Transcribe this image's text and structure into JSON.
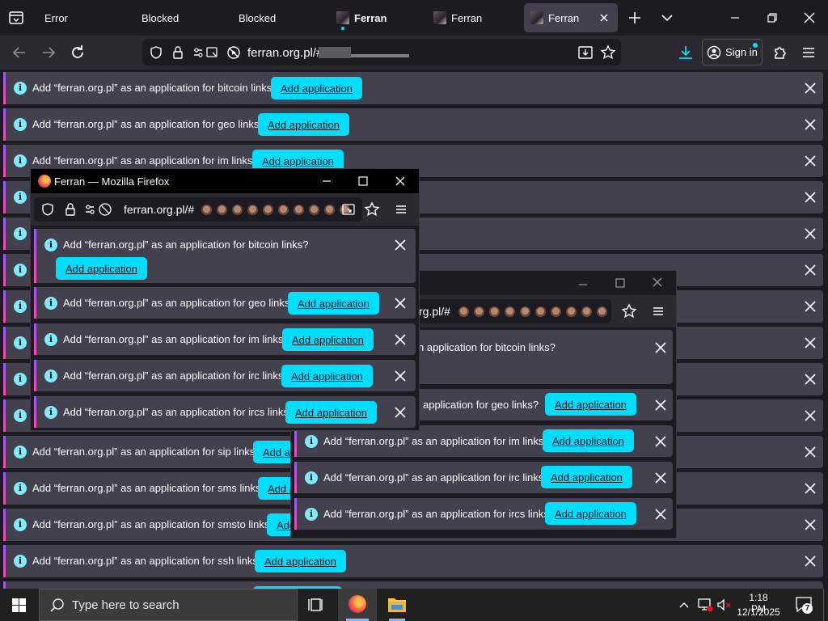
{
  "tabs": [
    {
      "label": "Error"
    },
    {
      "label": "Blocked"
    },
    {
      "label": "Blocked"
    },
    {
      "label": "Ferran"
    },
    {
      "label": "Ferran"
    },
    {
      "label": "Ferran"
    }
  ],
  "url": {
    "text": "ferran.org.pl/#"
  },
  "toolbar": {
    "signin_label": "Sign in"
  },
  "notifications": [
    {
      "message": "Add “ferran.org.pl” as an application for bitcoin links?",
      "button": "Add application"
    },
    {
      "message": "Add “ferran.org.pl” as an application for geo links?",
      "button": "Add application"
    },
    {
      "message": "Add “ferran.org.pl” as an application for im links?",
      "button": "Add application"
    },
    {
      "message": "Add “ferran.org.pl” as an application for sip links?",
      "button": "Add application"
    },
    {
      "message": "Add “ferran.org.pl” as an application for sms links?",
      "button": "Add application"
    },
    {
      "message": "Add “ferran.org.pl” as an application for smsto links?",
      "button": "Add application"
    },
    {
      "message": "Add “ferran.org.pl” as an application for ssh links?",
      "button": "Add application"
    }
  ],
  "popup1": {
    "title": "Ferran — Mozilla Firefox",
    "url": "ferran.org.pl/#",
    "notifications": [
      {
        "message": "Add “ferran.org.pl” as an application for bitcoin links?",
        "button": "Add application"
      },
      {
        "message": "Add “ferran.org.pl” as an application for geo links?",
        "button": "Add application"
      },
      {
        "message": "Add “ferran.org.pl” as an application for im links?",
        "button": "Add application"
      },
      {
        "message": "Add “ferran.org.pl” as an application for irc links?",
        "button": "Add application"
      },
      {
        "message": "Add “ferran.org.pl” as an application for ircs links?",
        "button": "Add application"
      }
    ]
  },
  "popup2": {
    "url": "rg.pl/#",
    "notifications": [
      {
        "message": "n application for bitcoin links?"
      },
      {
        "message": "application for geo links?",
        "button": "Add application"
      },
      {
        "message": "Add “ferran.org.pl” as an application for im links?",
        "button": "Add application"
      },
      {
        "message": "Add “ferran.org.pl” as an application for irc links?",
        "button": "Add application"
      },
      {
        "message": "Add “ferran.org.pl” as an application for ircs links?",
        "button": "Add application"
      }
    ]
  },
  "taskbar": {
    "search_placeholder": "Type here to search",
    "time": "1:18 PM",
    "date": "12/1/2025",
    "notification_count": "7"
  },
  "colors": {
    "accent": "#00ddff",
    "infobar": "#42414d",
    "background": "#1c1b22",
    "toolbar": "#2b2a33"
  }
}
